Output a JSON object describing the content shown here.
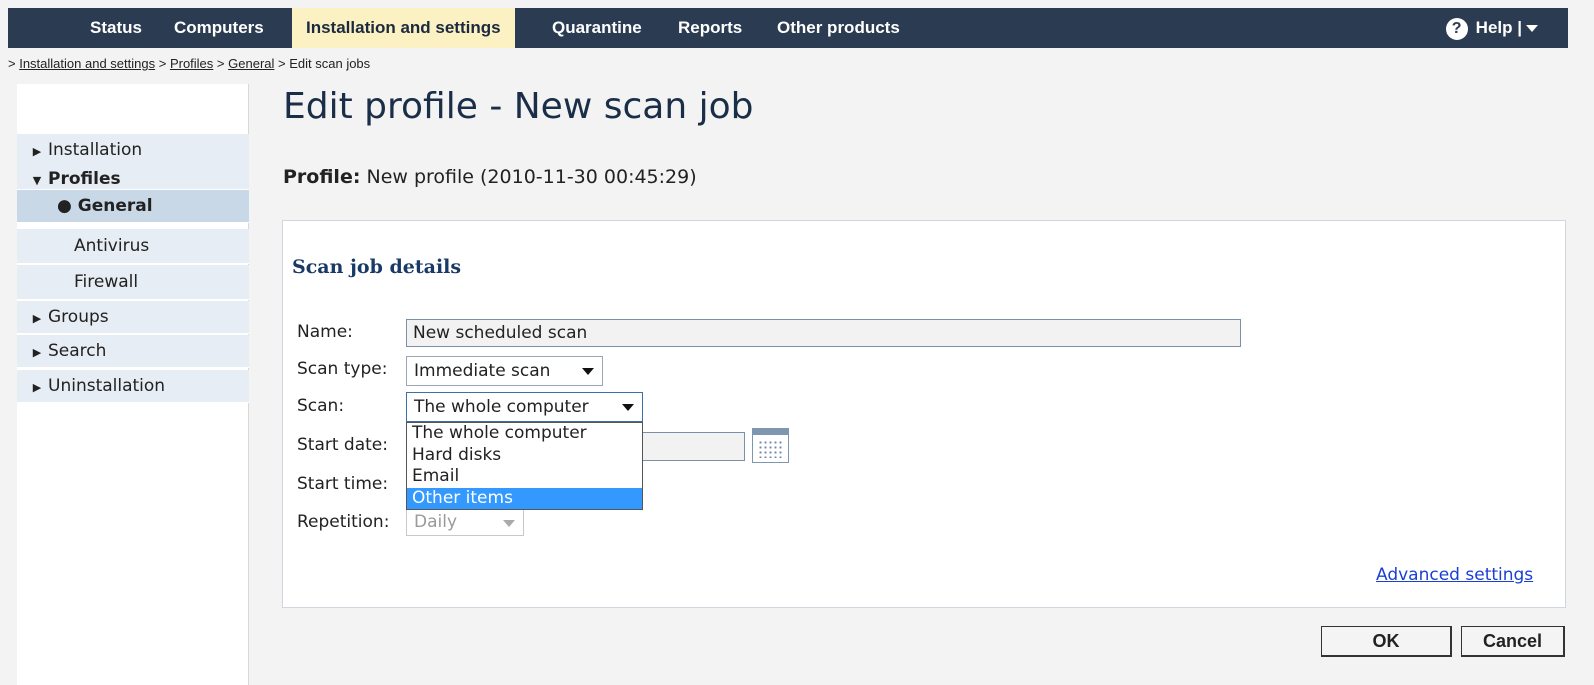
{
  "topnav": {
    "items": [
      "Status",
      "Computers",
      "Installation and settings",
      "Quarantine",
      "Reports",
      "Other products"
    ],
    "help_icon": "?",
    "help_label": "Help |"
  },
  "breadcrumb": {
    "prefix": ">",
    "links": [
      "Installation and settings",
      "Profiles",
      "General"
    ],
    "separator": ">",
    "current": "Edit scan jobs"
  },
  "sidebar": {
    "items": [
      {
        "label": "Installation",
        "marker": "▶"
      },
      {
        "label": "Profiles",
        "marker": "▼"
      },
      {
        "label": "General",
        "marker": "●"
      },
      {
        "label": "Antivirus"
      },
      {
        "label": "Firewall"
      },
      {
        "label": "Groups",
        "marker": "▶"
      },
      {
        "label": "Search",
        "marker": "▶"
      },
      {
        "label": "Uninstallation",
        "marker": "▶"
      }
    ]
  },
  "page": {
    "title": "Edit profile -  New scan job",
    "profile_label": "Profile:",
    "profile_value": "New profile (2010-11-30 00:45:29)"
  },
  "scan_job": {
    "section_title": "Scan job details",
    "name_label": "Name:",
    "name_value": "New scheduled scan",
    "scan_type_label": "Scan type:",
    "scan_type_value": "Immediate scan",
    "scan_label": "Scan:",
    "scan_value": "The whole computer",
    "scan_options": [
      "The whole computer",
      "Hard disks",
      "Email",
      "Other items"
    ],
    "scan_highlighted": "Other items",
    "start_date_label": "Start date:",
    "start_time_label": "Start time:",
    "repetition_label": "Repetition:",
    "repetition_value": "Daily",
    "advanced_link": "Advanced settings"
  },
  "buttons": {
    "ok": "OK",
    "cancel": "Cancel"
  },
  "colors": {
    "nav_bg": "#2a3b52",
    "nav_active_bg": "#fbf1c2",
    "highlight": "#3399ff",
    "link": "#1a3fd4"
  }
}
